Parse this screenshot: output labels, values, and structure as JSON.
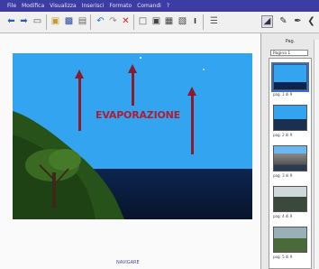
{
  "menu": [
    "File",
    "Modifica",
    "Visualizza",
    "Inserisci",
    "Formato",
    "Comandi",
    "?"
  ],
  "toolbar": {
    "icons": [
      "back-arrow-icon",
      "forward-arrow-icon",
      "page-icon",
      "open-folder-icon",
      "save-icon",
      "print-icon",
      "undo-icon",
      "redo-icon",
      "delete-icon",
      "window-icon",
      "monitor-icon",
      "display-icon",
      "presentation-icon",
      "text-icon",
      "sidebar-toggle-icon",
      "pointer-icon",
      "pen-icon",
      "brush-icon"
    ]
  },
  "slide": {
    "label": "EVAPORAZIONE",
    "sky_color": "#33a4ef",
    "sea_color": "#0c2550",
    "arrow_color": "#8a1a2c"
  },
  "footer": "NAVIGARE",
  "panel": {
    "title": "Pag.",
    "selector": "Pagina 1",
    "thumbnails": [
      {
        "caption": "pag. 1 di 9"
      },
      {
        "caption": "pag. 2 di 9"
      },
      {
        "caption": "pag. 3 di 9"
      },
      {
        "caption": "pag. 4 di 9"
      },
      {
        "caption": "pag. 5 di 9"
      }
    ]
  }
}
